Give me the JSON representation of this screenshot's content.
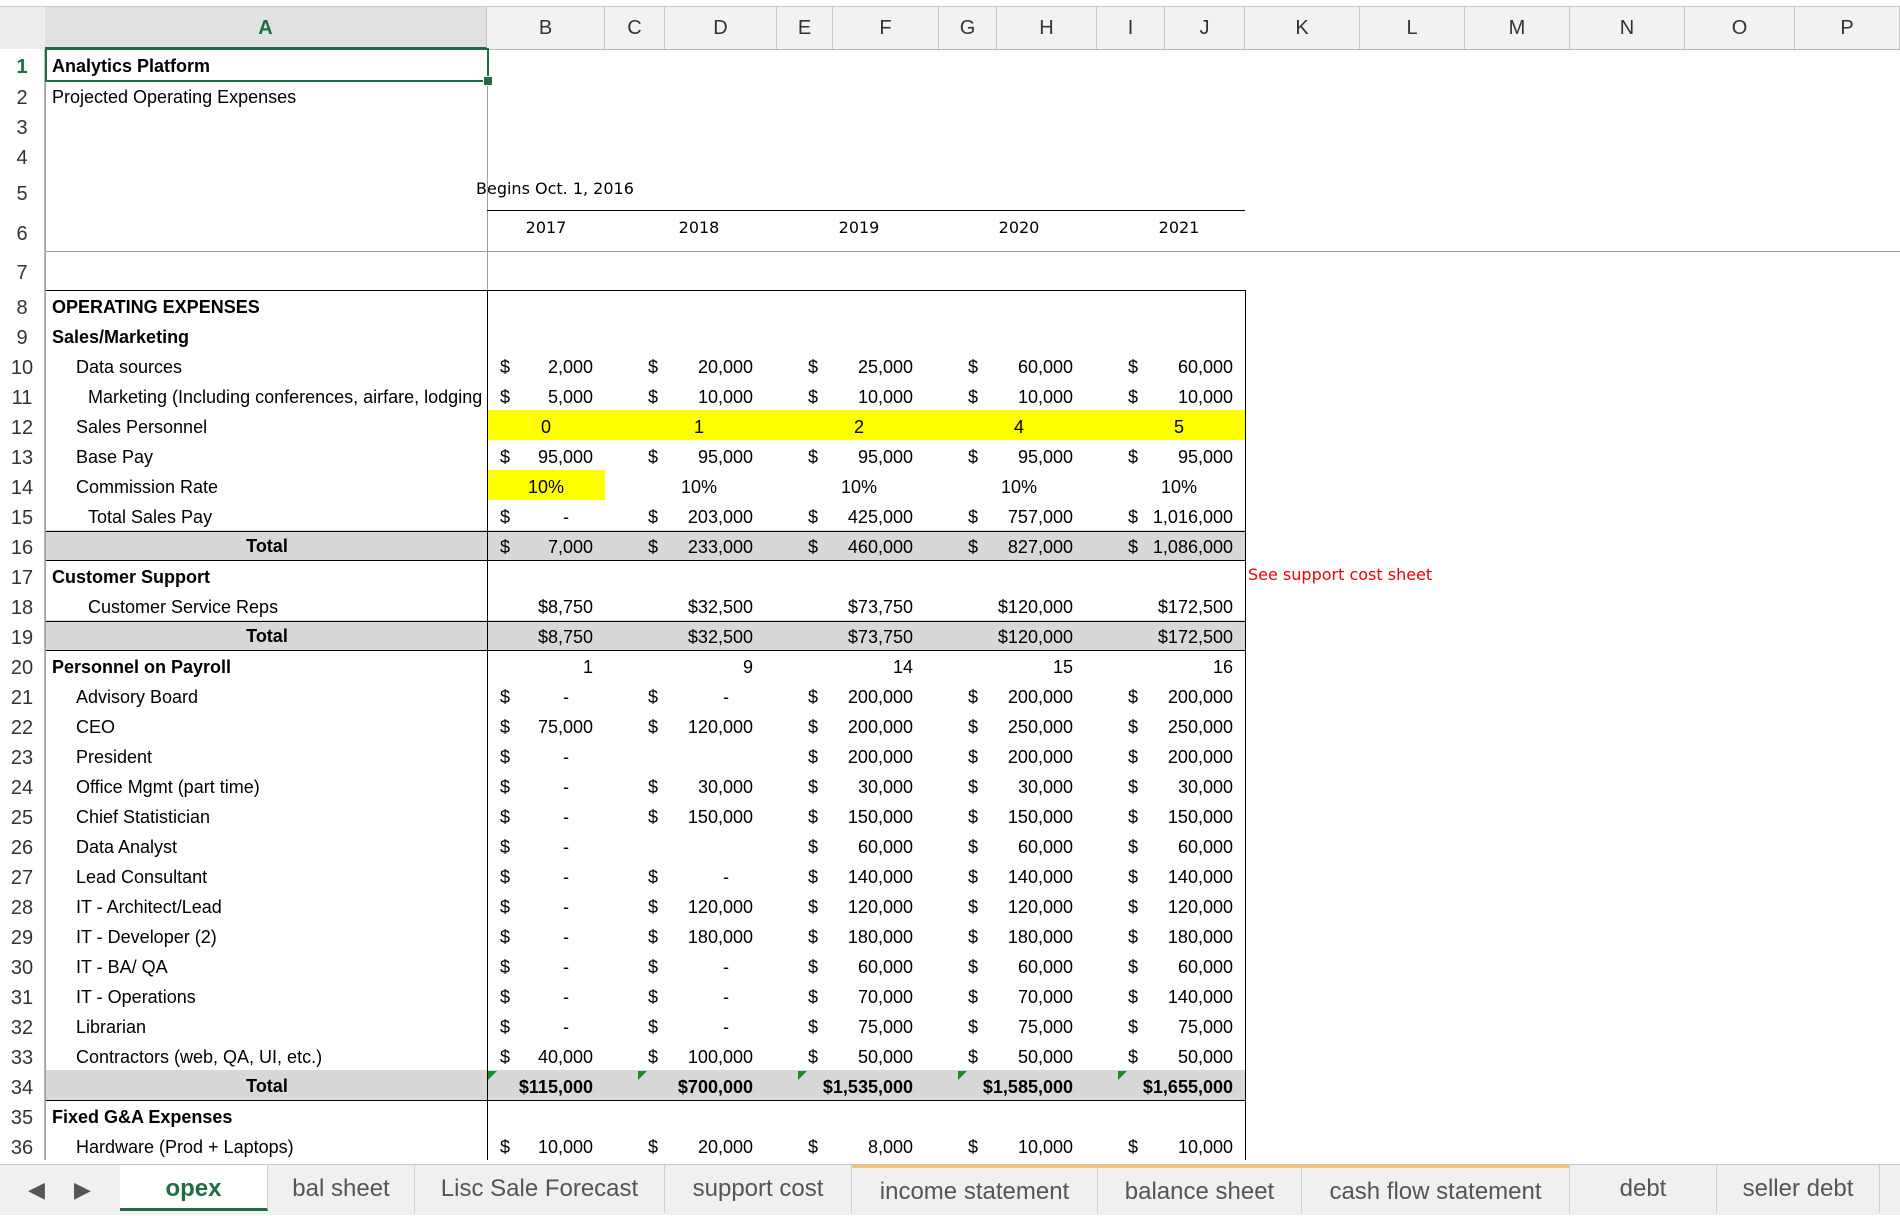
{
  "columns": [
    "A",
    "B",
    "C",
    "D",
    "E",
    "F",
    "G",
    "H",
    "I",
    "J",
    "K",
    "L",
    "M",
    "N",
    "O",
    "P"
  ],
  "selected_column": "A",
  "rows": [
    "1",
    "2",
    "3",
    "4",
    "5",
    "6",
    "7",
    "8",
    "9",
    "10",
    "11",
    "12",
    "13",
    "14",
    "15",
    "16",
    "17",
    "18",
    "19",
    "20",
    "21",
    "22",
    "23",
    "24",
    "25",
    "26",
    "27",
    "28",
    "29",
    "30",
    "31",
    "32",
    "33",
    "34",
    "35",
    "36"
  ],
  "selected_row": "1",
  "title": "Analytics Platform",
  "subtitle": "Projected Operating Expenses",
  "begins": "Begins Oct. 1, 2016",
  "years": [
    "2017",
    "2018",
    "2019",
    "2020",
    "2021"
  ],
  "note": "See support cost sheet",
  "labels": {
    "opex": "OPERATING EXPENSES",
    "sales": "Sales/Marketing",
    "data_sources": "Data sources",
    "marketing": "Marketing (Including conferences, airfare, lodging",
    "sales_personnel": "Sales Personnel",
    "base_pay": "Base Pay",
    "commission": "Commission Rate",
    "total_sales_pay": "Total Sales Pay",
    "total": "Total",
    "customer_support": "Customer Support",
    "csr": "Customer Service Reps",
    "payroll": "Personnel on Payroll",
    "advisory": "Advisory Board",
    "ceo": "CEO",
    "president": "President",
    "office": "Office Mgmt (part time)",
    "chief_stat": "Chief Statistician",
    "analyst": "Data Analyst",
    "lead_consultant": "Lead Consultant",
    "it_arch": "IT - Architect/Lead",
    "it_dev": "IT - Developer (2)",
    "it_ba": "IT - BA/ QA",
    "it_ops": "IT - Operations",
    "librarian": "Librarian",
    "contractors": "Contractors (web, QA, UI, etc.)",
    "fixed": "Fixed G&A Expenses",
    "hardware": "Hardware (Prod + Laptops)"
  },
  "cur": "$",
  "data_sources": [
    "2,000",
    "20,000",
    "25,000",
    "60,000",
    "60,000"
  ],
  "marketing": [
    "5,000",
    "10,000",
    "10,000",
    "10,000",
    "10,000"
  ],
  "sales_personnel": [
    "0",
    "1",
    "2",
    "4",
    "5"
  ],
  "base_pay": [
    "95,000",
    "95,000",
    "95,000",
    "95,000",
    "95,000"
  ],
  "commission": [
    "10%",
    "10%",
    "10%",
    "10%",
    "10%"
  ],
  "total_sales_pay": [
    "-",
    "203,000",
    "425,000",
    "757,000",
    "1,016,000"
  ],
  "sales_total": [
    "7,000",
    "233,000",
    "460,000",
    "827,000",
    "1,086,000"
  ],
  "csr": [
    "$8,750",
    "$32,500",
    "$73,750",
    "$120,000",
    "$172,500"
  ],
  "cs_total": [
    "$8,750",
    "$32,500",
    "$73,750",
    "$120,000",
    "$172,500"
  ],
  "headcount": [
    "1",
    "9",
    "14",
    "15",
    "16"
  ],
  "advisory": [
    "-",
    "-",
    "200,000",
    "200,000",
    "200,000"
  ],
  "ceo": [
    "75,000",
    "120,000",
    "200,000",
    "250,000",
    "250,000"
  ],
  "president": [
    "-",
    "",
    "200,000",
    "200,000",
    "200,000"
  ],
  "office": [
    "-",
    "30,000",
    "30,000",
    "30,000",
    "30,000"
  ],
  "chief_stat": [
    "-",
    "150,000",
    "150,000",
    "150,000",
    "150,000"
  ],
  "analyst": [
    "-",
    "",
    "60,000",
    "60,000",
    "60,000"
  ],
  "lead_consultant": [
    "-",
    "-",
    "140,000",
    "140,000",
    "140,000"
  ],
  "it_arch": [
    "-",
    "120,000",
    "120,000",
    "120,000",
    "120,000"
  ],
  "it_dev": [
    "-",
    "180,000",
    "180,000",
    "180,000",
    "180,000"
  ],
  "it_ba": [
    "-",
    "-",
    "60,000",
    "60,000",
    "60,000"
  ],
  "it_ops": [
    "-",
    "-",
    "70,000",
    "70,000",
    "140,000"
  ],
  "librarian": [
    "-",
    "-",
    "75,000",
    "75,000",
    "75,000"
  ],
  "contractors": [
    "40,000",
    "100,000",
    "50,000",
    "50,000",
    "50,000"
  ],
  "payroll_total": [
    "$115,000",
    "$700,000",
    "$1,535,000",
    "$1,585,000",
    "$1,655,000"
  ],
  "hardware": [
    "10,000",
    "20,000",
    "8,000",
    "10,000",
    "10,000"
  ],
  "tabs": [
    "opex",
    "bal sheet",
    "Lisc Sale Forecast",
    "support cost",
    "income statement",
    "balance sheet",
    "cash flow statement",
    "debt",
    "seller debt"
  ],
  "active_tab": "opex",
  "nav": {
    "prev": "◀",
    "next": "▶"
  }
}
